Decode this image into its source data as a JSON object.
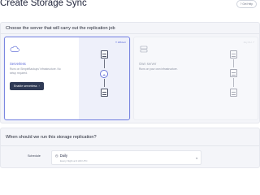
{
  "page": {
    "title": "Create Storage Sync",
    "help_label": "Get Help",
    "help_icon": "question-circle-icon"
  },
  "server_card": {
    "heading": "Choose the server that will carry out the replication job",
    "options": [
      {
        "title": "Serverless",
        "description": "Runs on SimpleBackups' infrastructure. No setup required.",
        "button_label": "Enable serverless",
        "badge": "Efficient",
        "icon": "cloud-icon",
        "selected": true
      },
      {
        "title": "Own server",
        "description": "Runs on your own infrastructure.",
        "badge": "Any CLI",
        "icon": "server-icon",
        "selected": false
      }
    ]
  },
  "schedule_card": {
    "heading": "When should we run this storage replication?",
    "label": "Schedule",
    "value": "Daily",
    "subtext": "Every Night at 3 AM UTC",
    "icon": "clock-icon",
    "caret_icon": "chevron-down-icon"
  },
  "colors": {
    "accent": "#5a67d8",
    "selected_border": "#7a86e0",
    "dark_button": "#2f3a55",
    "card_bg": "#f4f5f9"
  }
}
